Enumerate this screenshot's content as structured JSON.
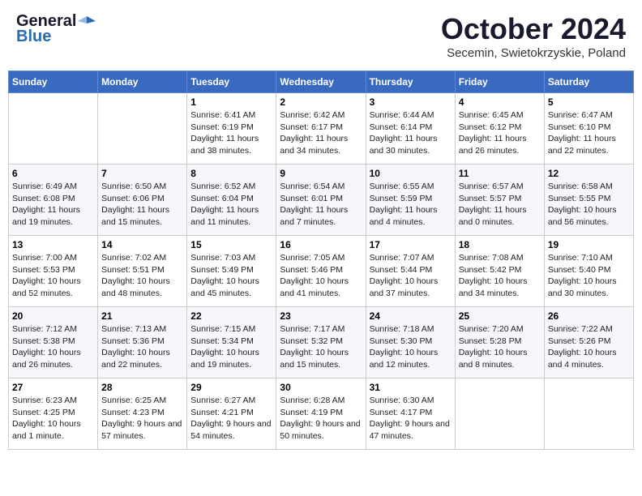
{
  "header": {
    "logo_general": "General",
    "logo_blue": "Blue",
    "month_title": "October 2024",
    "location": "Secemin, Swietokrzyskie, Poland"
  },
  "days_of_week": [
    "Sunday",
    "Monday",
    "Tuesday",
    "Wednesday",
    "Thursday",
    "Friday",
    "Saturday"
  ],
  "weeks": [
    [
      {
        "day": "",
        "info": ""
      },
      {
        "day": "",
        "info": ""
      },
      {
        "day": "1",
        "info": "Sunrise: 6:41 AM\nSunset: 6:19 PM\nDaylight: 11 hours and 38 minutes."
      },
      {
        "day": "2",
        "info": "Sunrise: 6:42 AM\nSunset: 6:17 PM\nDaylight: 11 hours and 34 minutes."
      },
      {
        "day": "3",
        "info": "Sunrise: 6:44 AM\nSunset: 6:14 PM\nDaylight: 11 hours and 30 minutes."
      },
      {
        "day": "4",
        "info": "Sunrise: 6:45 AM\nSunset: 6:12 PM\nDaylight: 11 hours and 26 minutes."
      },
      {
        "day": "5",
        "info": "Sunrise: 6:47 AM\nSunset: 6:10 PM\nDaylight: 11 hours and 22 minutes."
      }
    ],
    [
      {
        "day": "6",
        "info": "Sunrise: 6:49 AM\nSunset: 6:08 PM\nDaylight: 11 hours and 19 minutes."
      },
      {
        "day": "7",
        "info": "Sunrise: 6:50 AM\nSunset: 6:06 PM\nDaylight: 11 hours and 15 minutes."
      },
      {
        "day": "8",
        "info": "Sunrise: 6:52 AM\nSunset: 6:04 PM\nDaylight: 11 hours and 11 minutes."
      },
      {
        "day": "9",
        "info": "Sunrise: 6:54 AM\nSunset: 6:01 PM\nDaylight: 11 hours and 7 minutes."
      },
      {
        "day": "10",
        "info": "Sunrise: 6:55 AM\nSunset: 5:59 PM\nDaylight: 11 hours and 4 minutes."
      },
      {
        "day": "11",
        "info": "Sunrise: 6:57 AM\nSunset: 5:57 PM\nDaylight: 11 hours and 0 minutes."
      },
      {
        "day": "12",
        "info": "Sunrise: 6:58 AM\nSunset: 5:55 PM\nDaylight: 10 hours and 56 minutes."
      }
    ],
    [
      {
        "day": "13",
        "info": "Sunrise: 7:00 AM\nSunset: 5:53 PM\nDaylight: 10 hours and 52 minutes."
      },
      {
        "day": "14",
        "info": "Sunrise: 7:02 AM\nSunset: 5:51 PM\nDaylight: 10 hours and 48 minutes."
      },
      {
        "day": "15",
        "info": "Sunrise: 7:03 AM\nSunset: 5:49 PM\nDaylight: 10 hours and 45 minutes."
      },
      {
        "day": "16",
        "info": "Sunrise: 7:05 AM\nSunset: 5:46 PM\nDaylight: 10 hours and 41 minutes."
      },
      {
        "day": "17",
        "info": "Sunrise: 7:07 AM\nSunset: 5:44 PM\nDaylight: 10 hours and 37 minutes."
      },
      {
        "day": "18",
        "info": "Sunrise: 7:08 AM\nSunset: 5:42 PM\nDaylight: 10 hours and 34 minutes."
      },
      {
        "day": "19",
        "info": "Sunrise: 7:10 AM\nSunset: 5:40 PM\nDaylight: 10 hours and 30 minutes."
      }
    ],
    [
      {
        "day": "20",
        "info": "Sunrise: 7:12 AM\nSunset: 5:38 PM\nDaylight: 10 hours and 26 minutes."
      },
      {
        "day": "21",
        "info": "Sunrise: 7:13 AM\nSunset: 5:36 PM\nDaylight: 10 hours and 22 minutes."
      },
      {
        "day": "22",
        "info": "Sunrise: 7:15 AM\nSunset: 5:34 PM\nDaylight: 10 hours and 19 minutes."
      },
      {
        "day": "23",
        "info": "Sunrise: 7:17 AM\nSunset: 5:32 PM\nDaylight: 10 hours and 15 minutes."
      },
      {
        "day": "24",
        "info": "Sunrise: 7:18 AM\nSunset: 5:30 PM\nDaylight: 10 hours and 12 minutes."
      },
      {
        "day": "25",
        "info": "Sunrise: 7:20 AM\nSunset: 5:28 PM\nDaylight: 10 hours and 8 minutes."
      },
      {
        "day": "26",
        "info": "Sunrise: 7:22 AM\nSunset: 5:26 PM\nDaylight: 10 hours and 4 minutes."
      }
    ],
    [
      {
        "day": "27",
        "info": "Sunrise: 6:23 AM\nSunset: 4:25 PM\nDaylight: 10 hours and 1 minute."
      },
      {
        "day": "28",
        "info": "Sunrise: 6:25 AM\nSunset: 4:23 PM\nDaylight: 9 hours and 57 minutes."
      },
      {
        "day": "29",
        "info": "Sunrise: 6:27 AM\nSunset: 4:21 PM\nDaylight: 9 hours and 54 minutes."
      },
      {
        "day": "30",
        "info": "Sunrise: 6:28 AM\nSunset: 4:19 PM\nDaylight: 9 hours and 50 minutes."
      },
      {
        "day": "31",
        "info": "Sunrise: 6:30 AM\nSunset: 4:17 PM\nDaylight: 9 hours and 47 minutes."
      },
      {
        "day": "",
        "info": ""
      },
      {
        "day": "",
        "info": ""
      }
    ]
  ]
}
